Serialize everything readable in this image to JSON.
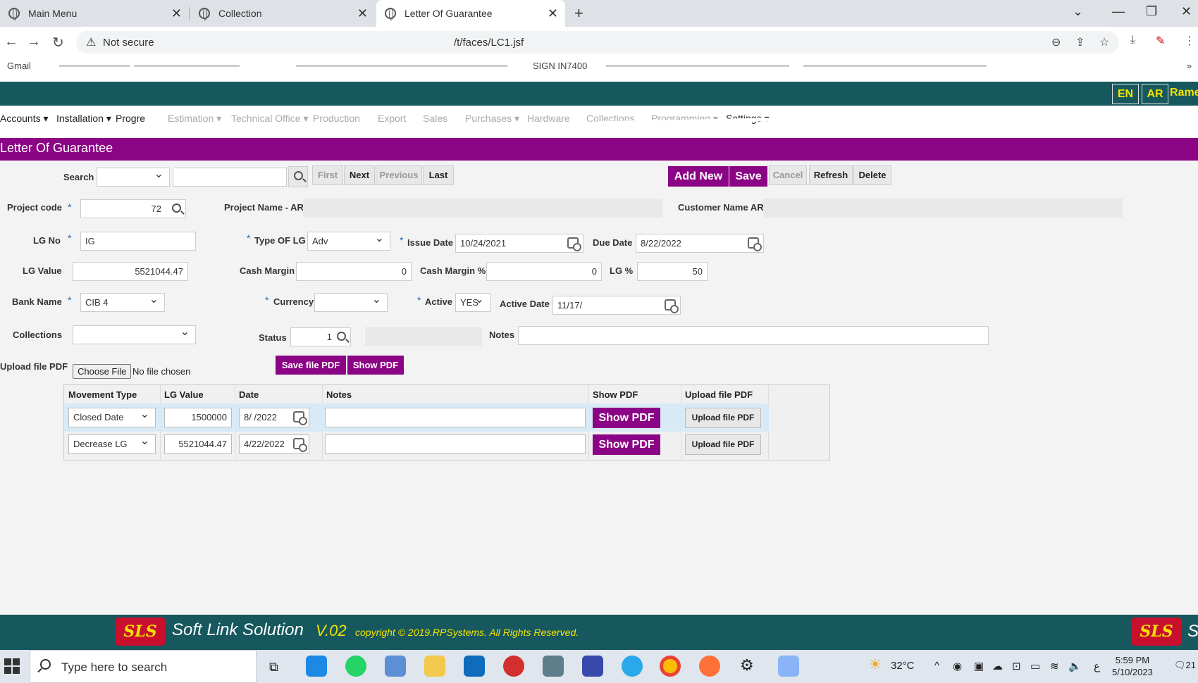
{
  "browser": {
    "tabs": [
      {
        "title": "Main Menu"
      },
      {
        "title": "Collection"
      },
      {
        "title": "Letter Of Guarantee"
      }
    ],
    "security": "Not secure",
    "url": "/t/faces/LC1.jsf",
    "bookmarks": [
      "Gmail",
      "SIGN IN7400"
    ]
  },
  "app": {
    "lang_en": "EN",
    "lang_ar": "AR",
    "user": "Rame",
    "menu": [
      {
        "label": "Accounts",
        "dim": false
      },
      {
        "label": "Installation",
        "dim": false
      },
      {
        "label": "Progre",
        "dim": false
      },
      {
        "label": "Estimation",
        "dim": true
      },
      {
        "label": "Technical Office",
        "dim": true
      },
      {
        "label": "Production",
        "dim": true
      },
      {
        "label": "Export",
        "dim": true
      },
      {
        "label": "Sales",
        "dim": true
      },
      {
        "label": "Purchases",
        "dim": true
      },
      {
        "label": "Hardware",
        "dim": true
      },
      {
        "label": "Collections",
        "dim": true
      },
      {
        "label": "Programming",
        "dim": true
      },
      {
        "label": "Settings",
        "dim": false
      }
    ],
    "page_title": "Letter Of Guarantee"
  },
  "toolbar": {
    "search_label": "Search",
    "first": "First",
    "next": "Next",
    "previous": "Previous",
    "last": "Last",
    "add_new": "Add New",
    "save": "Save",
    "cancel": "Cancel",
    "refresh": "Refresh",
    "delete": "Delete"
  },
  "form": {
    "project_code_label": "Project code",
    "project_code": "72",
    "project_name_label": "Project Name - AR",
    "customer_name_label": "Customer Name AR",
    "lg_no_label": "LG No",
    "lg_no": "IG",
    "type_lg_label": "Type OF LG",
    "type_lg": "Adv",
    "issue_date_label": "Issue Date",
    "issue_date": "10/24/2021",
    "due_date_label": "Due Date",
    "due_date": "8/22/2022",
    "lg_value_label": "LG Value",
    "lg_value": "5521044.47",
    "cash_margin_label": "Cash Margin",
    "cash_margin": "0",
    "cash_margin_pct_label": "Cash Margin %",
    "cash_margin_pct": "0",
    "lg_pct_label": "LG %",
    "lg_pct": "50",
    "bank_name_label": "Bank Name",
    "bank_name": "CIB 4",
    "currency_label": "Currency",
    "active_label": "Active",
    "active": "YES",
    "active_date_label": "Active Date",
    "active_date": "11/17/",
    "collections_label": "Collections",
    "status_label": "Status",
    "status": "1",
    "notes_label": "Notes",
    "upload_label": "Upload file PDF",
    "choose_file": "Choose File",
    "no_file": "No file chosen",
    "save_file_pdf": "Save file PDF",
    "show_pdf": "Show PDF"
  },
  "table": {
    "headers": [
      "Movement Type",
      "LG Value",
      "Date",
      "Notes",
      "Show PDF",
      "Upload file PDF"
    ],
    "rows": [
      {
        "movement_type": "Closed Date",
        "lg_value": "1500000",
        "date": "8/ /2022",
        "notes": "",
        "show_pdf": "Show PDF",
        "upload": "Upload file PDF"
      },
      {
        "movement_type": "Decrease LG",
        "lg_value": "5521044.47",
        "date": "4/22/2022",
        "notes": "",
        "show_pdf": "Show PDF",
        "upload": "Upload file PDF"
      }
    ]
  },
  "footer": {
    "logo": "SLS",
    "brand": "Soft Link Solution",
    "version": "V.02",
    "copyright": "copyright © 2019.RPSystems. All Rights Reserved.",
    "edge_text": "S"
  },
  "taskbar": {
    "search_placeholder": "Type here to search",
    "temperature": "32°C",
    "time": "5:59 PM",
    "date": "5/10/2023",
    "notifications": "21"
  },
  "colors": {
    "teal": "#16585e",
    "purple": "#8b0485",
    "yellow": "#f4e300"
  }
}
